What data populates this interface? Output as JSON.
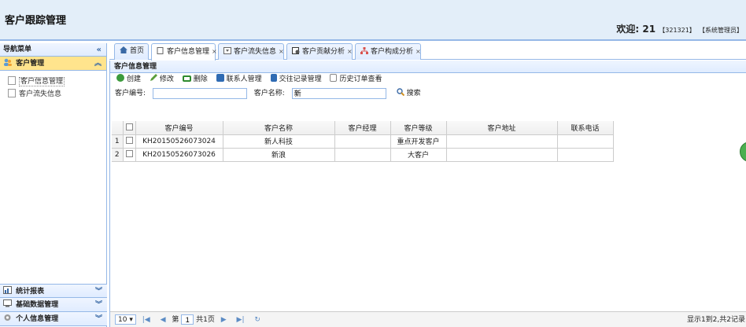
{
  "app": {
    "title": "客户跟踪管理"
  },
  "header": {
    "welcome": "欢迎:",
    "user_id": "21",
    "user_code": "【321321】",
    "role": "【系统管理员】"
  },
  "sidebar": {
    "title": "导航菜单",
    "collapse": "«",
    "groups": [
      {
        "label": "客户管理",
        "tool": "︽",
        "items": [
          "客户信息管理",
          "客户流失信息"
        ]
      },
      {
        "label": "统计报表",
        "tool": "︾"
      },
      {
        "label": "基础数据管理",
        "tool": "︾"
      },
      {
        "label": "个人信息管理",
        "tool": "︾"
      }
    ]
  },
  "tabs": [
    {
      "label": "首页",
      "close": ""
    },
    {
      "label": "客户信息管理",
      "close": "×"
    },
    {
      "label": "客户流失信息",
      "close": "×"
    },
    {
      "label": "客户贡献分析",
      "close": "×"
    },
    {
      "label": "客户构成分析",
      "close": "×"
    }
  ],
  "grid": {
    "title": "客户信息管理",
    "toolbar": [
      "创建",
      "修改",
      "删除",
      "联系人管理",
      "交往记录管理",
      "历史订单查看"
    ],
    "search": {
      "code_label": "客户编号:",
      "code_value": "",
      "name_label": "客户名称:",
      "name_value": "新",
      "button": "搜索"
    },
    "columns": [
      "客户编号",
      "客户名称",
      "客户经理",
      "客户等级",
      "客户地址",
      "联系电话"
    ],
    "rows": [
      {
        "num": "1",
        "code": "KH20150526073024",
        "name": "新人科技",
        "manager": "",
        "level": "重点开发客户",
        "address": "",
        "phone": ""
      },
      {
        "num": "2",
        "code": "KH20150526073026",
        "name": "新浪",
        "manager": "",
        "level": "大客户",
        "address": "",
        "phone": ""
      }
    ]
  },
  "pager": {
    "page_size": "10",
    "page_label": "第",
    "page_value": "1",
    "total_pages": "共1页",
    "info": "显示1到2,共2记录"
  },
  "colors": {
    "border": "#95b8e7",
    "header_bg": "#e3eef9",
    "selected": "#ffe48d"
  },
  "icons": [
    "collapse-icon",
    "customer-group-icon",
    "home-icon",
    "add-icon",
    "edit-icon",
    "delete-icon",
    "contacts-icon",
    "record-icon",
    "history-icon",
    "search-icon",
    "refresh-icon"
  ]
}
